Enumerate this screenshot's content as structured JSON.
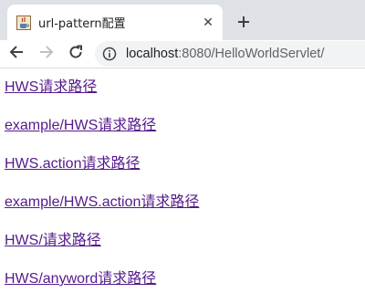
{
  "browser": {
    "tab": {
      "title": "url-pattern配置",
      "favicon": "java-coffee-icon",
      "close_glyph": "✕"
    },
    "new_tab_icon": "plus-icon",
    "nav": {
      "back_icon": "arrow-left-icon",
      "forward_icon": "arrow-right-icon",
      "reload_icon": "reload-icon",
      "forward_enabled": false
    },
    "address_bar": {
      "security_icon": "info-icon",
      "host": "localhost",
      "path": ":8080/HelloWorldServlet/"
    }
  },
  "page": {
    "link_color": "#551a8b",
    "links": [
      "HWS请求路径",
      "example/HWS请求路径",
      "HWS.action请求路径",
      "example/HWS.action请求路径",
      "HWS/请求路径",
      "HWS/anyword请求路径"
    ]
  }
}
